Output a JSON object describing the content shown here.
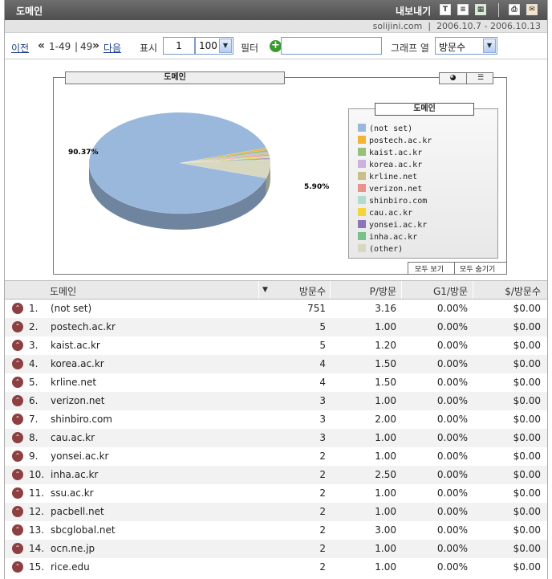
{
  "titlebar": {
    "title": "도메인",
    "export_label": "내보내기"
  },
  "subbar": {
    "site": "solijini.com",
    "date_range": "2006.10.7 - 2006.10.13"
  },
  "nav": {
    "prev": "이전",
    "range": "1-49",
    "sep": "|",
    "total": "49",
    "next": "다음",
    "show_label": "표시",
    "start_value": "1",
    "page_size": "100",
    "filter_label": "필터",
    "filter_value": "",
    "graph_col_label": "그래프 열",
    "graph_col_value": "방문수"
  },
  "chart": {
    "header": "도메인",
    "legend_title": "도메인",
    "show_all": "모두 보기",
    "hide_all": "모두 숨기기",
    "label_main": "90.37%",
    "label_minor": "5.90%"
  },
  "chart_data": {
    "type": "pie",
    "labels": [
      "(not set)",
      "postech.ac.kr",
      "kaist.ac.kr",
      "korea.ac.kr",
      "krline.net",
      "verizon.net",
      "shinbiro.com",
      "cau.ac.kr",
      "yonsei.ac.kr",
      "inha.ac.kr",
      "(other)"
    ],
    "values": [
      90.37,
      0.6,
      0.6,
      0.48,
      0.48,
      0.36,
      0.36,
      0.36,
      0.24,
      0.24,
      5.9
    ],
    "colors": [
      "#9ab8dc",
      "#f2b435",
      "#99c07a",
      "#ccb0dd",
      "#c8c08a",
      "#e8948c",
      "#b0dcd0",
      "#f5d43a",
      "#8c74b8",
      "#78c08c",
      "#d8d8c0"
    ]
  },
  "table": {
    "headers": [
      "도메인",
      "방문수",
      "P/방문",
      "G1/방문",
      "$/방문수"
    ],
    "rows": [
      {
        "n": "1.",
        "domain": "(not set)",
        "visits": "751",
        "ppv": "3.16",
        "g1": "0.00%",
        "dpv": "$0.00"
      },
      {
        "n": "2.",
        "domain": "postech.ac.kr",
        "visits": "5",
        "ppv": "1.00",
        "g1": "0.00%",
        "dpv": "$0.00"
      },
      {
        "n": "3.",
        "domain": "kaist.ac.kr",
        "visits": "5",
        "ppv": "1.20",
        "g1": "0.00%",
        "dpv": "$0.00"
      },
      {
        "n": "4.",
        "domain": "korea.ac.kr",
        "visits": "4",
        "ppv": "1.50",
        "g1": "0.00%",
        "dpv": "$0.00"
      },
      {
        "n": "5.",
        "domain": "krline.net",
        "visits": "4",
        "ppv": "1.50",
        "g1": "0.00%",
        "dpv": "$0.00"
      },
      {
        "n": "6.",
        "domain": "verizon.net",
        "visits": "3",
        "ppv": "1.00",
        "g1": "0.00%",
        "dpv": "$0.00"
      },
      {
        "n": "7.",
        "domain": "shinbiro.com",
        "visits": "3",
        "ppv": "2.00",
        "g1": "0.00%",
        "dpv": "$0.00"
      },
      {
        "n": "8.",
        "domain": "cau.ac.kr",
        "visits": "3",
        "ppv": "1.00",
        "g1": "0.00%",
        "dpv": "$0.00"
      },
      {
        "n": "9.",
        "domain": "yonsei.ac.kr",
        "visits": "2",
        "ppv": "1.00",
        "g1": "0.00%",
        "dpv": "$0.00"
      },
      {
        "n": "10.",
        "domain": "inha.ac.kr",
        "visits": "2",
        "ppv": "2.50",
        "g1": "0.00%",
        "dpv": "$0.00"
      },
      {
        "n": "11.",
        "domain": "ssu.ac.kr",
        "visits": "2",
        "ppv": "1.00",
        "g1": "0.00%",
        "dpv": "$0.00"
      },
      {
        "n": "12.",
        "domain": "pacbell.net",
        "visits": "2",
        "ppv": "1.00",
        "g1": "0.00%",
        "dpv": "$0.00"
      },
      {
        "n": "13.",
        "domain": "sbcglobal.net",
        "visits": "2",
        "ppv": "3.00",
        "g1": "0.00%",
        "dpv": "$0.00"
      },
      {
        "n": "14.",
        "domain": "ocn.ne.jp",
        "visits": "2",
        "ppv": "1.00",
        "g1": "0.00%",
        "dpv": "$0.00"
      },
      {
        "n": "15.",
        "domain": "rice.edu",
        "visits": "2",
        "ppv": "1.00",
        "g1": "0.00%",
        "dpv": "$0.00"
      }
    ]
  }
}
